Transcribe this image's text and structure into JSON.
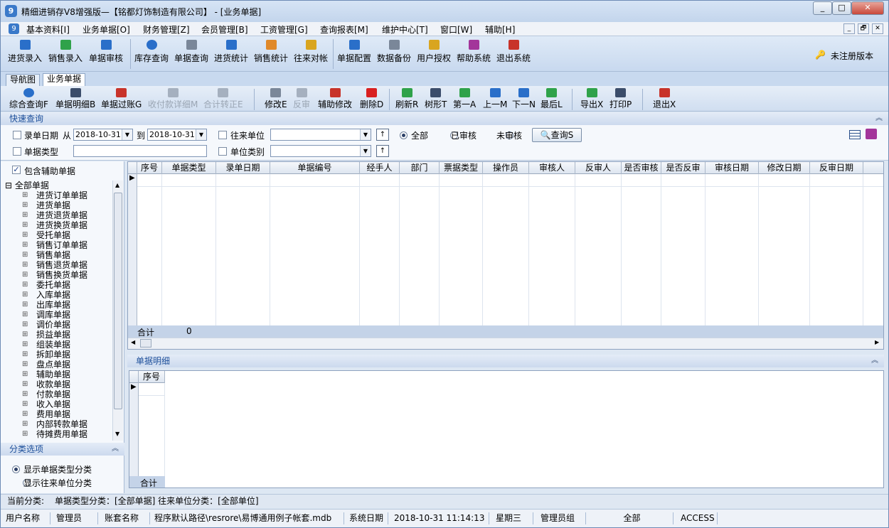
{
  "window": {
    "title": "精细进销存V8增强版—【铭都灯饰制造有限公司】 - [业务单据]",
    "controls": [
      "_",
      "□",
      "✕"
    ]
  },
  "menu": [
    "基本资料[I]",
    "业务单据[O]",
    "财务管理[Z]",
    "会员管理[B]",
    "工资管理[G]",
    "查询报表[M]",
    "维护中心[T]",
    "窗口[W]",
    "辅助[H]"
  ],
  "mdi_controls": [
    "_",
    "🗗",
    "✕"
  ],
  "toolbar": [
    {
      "label": "进货录入",
      "icon": "save-icon",
      "color": "#2a6fc9"
    },
    {
      "label": "销售录入",
      "icon": "cart-icon",
      "color": "#2fa24a"
    },
    {
      "label": "单据审核",
      "icon": "check-icon",
      "color": "#2a6fc9"
    },
    {
      "label": "库存查询",
      "icon": "search-icon",
      "color": "#2a6fc9"
    },
    {
      "label": "单据查询",
      "icon": "doc-search-icon",
      "color": "#7a8799"
    },
    {
      "label": "进货统计",
      "icon": "chart-icon",
      "color": "#2a6fc9"
    },
    {
      "label": "销售统计",
      "icon": "stats-icon",
      "color": "#e0892a"
    },
    {
      "label": "往来对帐",
      "icon": "money-icon",
      "color": "#d9a51f"
    },
    {
      "label": "单据配置",
      "icon": "config-icon",
      "color": "#2a6fc9"
    },
    {
      "label": "数据备份",
      "icon": "backup-icon",
      "color": "#7a8799"
    },
    {
      "label": "用户授权",
      "icon": "user-icon",
      "color": "#d9a51f"
    },
    {
      "label": "帮助系统",
      "icon": "help-book-icon",
      "color": "#a3359a"
    },
    {
      "label": "退出系统",
      "icon": "exit-icon",
      "color": "#c8332a"
    }
  ],
  "unregistered": "未注册版本",
  "tabs": [
    "导航图",
    "业务单据"
  ],
  "toolbar2": [
    {
      "label": "综合查询F",
      "icon": "magnifier-icon",
      "color": "#2a6fc9",
      "enabled": true
    },
    {
      "label": "单据明细B",
      "icon": "table-icon",
      "color": "#3b4d6b",
      "enabled": true
    },
    {
      "label": "单据过账G",
      "icon": "post-icon",
      "color": "#c8332a",
      "enabled": true
    },
    {
      "label": "收付款详细M",
      "icon": "payment-icon",
      "color": "#a5b0bf",
      "enabled": false
    },
    {
      "label": "合计转正E",
      "icon": "sum-icon",
      "color": "#a5b0bf",
      "enabled": false
    },
    {
      "label": "修改E",
      "icon": "edit-icon",
      "color": "#7a8799",
      "enabled": true
    },
    {
      "label": "反审",
      "icon": "unaudit-icon",
      "color": "#a5b0bf",
      "enabled": false
    },
    {
      "label": "辅助修改",
      "icon": "aux-edit-icon",
      "color": "#c8332a",
      "enabled": true
    },
    {
      "label": "删除D",
      "icon": "delete-icon",
      "color": "#d92020",
      "enabled": true
    },
    {
      "label": "刷新R",
      "icon": "refresh-icon",
      "color": "#2fa24a",
      "enabled": true
    },
    {
      "label": "树形T",
      "icon": "tree-icon",
      "color": "#3b4d6b",
      "enabled": true
    },
    {
      "label": "第一A",
      "icon": "first-icon",
      "color": "#2fa24a",
      "enabled": true
    },
    {
      "label": "上一M",
      "icon": "prev-icon",
      "color": "#2a6fc9",
      "enabled": true
    },
    {
      "label": "下一N",
      "icon": "next-icon",
      "color": "#2a6fc9",
      "enabled": true
    },
    {
      "label": "最后L",
      "icon": "last-icon",
      "color": "#2fa24a",
      "enabled": true
    },
    {
      "label": "导出X",
      "icon": "export-icon",
      "color": "#2fa24a",
      "enabled": true
    },
    {
      "label": "打印P",
      "icon": "print-icon",
      "color": "#3b4d6b",
      "enabled": true
    },
    {
      "label": "退出X",
      "icon": "exit-icon",
      "color": "#c8332a",
      "enabled": true
    }
  ],
  "quick_search": {
    "header": "快速查询",
    "date_label": "录单日期",
    "from": "从",
    "from_value": "2018-10-31",
    "to": "到",
    "to_value": "2018-10-31",
    "partner_label": "往来单位",
    "partner_value": "",
    "type_label": "单据类型",
    "type_value": "",
    "unit_cat_label": "单位类别",
    "unit_cat_value": "",
    "radio_all": "全部",
    "radio_audited": "已审核",
    "radio_unaudited": "未审核",
    "query_button": "查询S"
  },
  "left": {
    "include_aux": "包含辅助单据",
    "tree_root": "全部单据",
    "tree_items": [
      "进货订单单据",
      "进货单据",
      "进货退货单据",
      "进货换货单据",
      "受托单据",
      "销售订单单据",
      "销售单据",
      "销售退货单据",
      "销售换货单据",
      "委托单据",
      "入库单据",
      "出库单据",
      "调库单据",
      "调价单据",
      "损益单据",
      "组装单据",
      "拆卸单据",
      "盘点单据",
      "辅助单据",
      "收款单据",
      "付款单据",
      "收入单据",
      "费用单据",
      "内部转款单据",
      "待摊费用单据"
    ],
    "category_header": "分类选项",
    "opt_doc_type": "显示单据类型分类",
    "opt_partner": "显示往来单位分类"
  },
  "main_grid": {
    "columns": [
      "序号",
      "单据类型",
      "录单日期",
      "单据编号",
      "经手人",
      "部门",
      "票据类型",
      "操作员",
      "审核人",
      "反审人",
      "是否审核",
      "是否反审",
      "审核日期",
      "修改日期",
      "反审日期"
    ],
    "total_label": "合计",
    "total_value": "0"
  },
  "detail": {
    "header": "单据明细",
    "columns": [
      "序号"
    ],
    "total_label": "合计"
  },
  "current_category": {
    "label": "当前分类:",
    "value": "单据类型分类：[全部单据] 往来单位分类：[全部单位]"
  },
  "statusbar": [
    "用户名称",
    "管理员",
    "账套名称",
    "程序默认路径\\resrore\\易博通用例子帐套.mdb",
    "系统日期",
    "2018-10-31    11:14:13",
    "星期三",
    "管理员组",
    "全部",
    "ACCESS"
  ]
}
